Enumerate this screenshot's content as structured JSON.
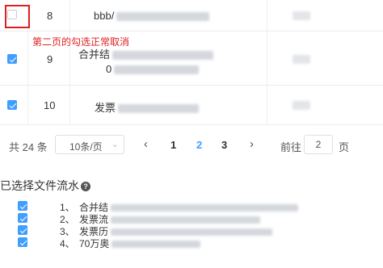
{
  "table": {
    "rows": [
      {
        "index": "8",
        "name_visible": "bbb/",
        "checked": false
      },
      {
        "index": "9",
        "name_visible": "合并结",
        "name_line2": "0",
        "checked": true
      },
      {
        "index": "10",
        "name_visible": "发票",
        "checked": true
      }
    ]
  },
  "annotation": "第二页的勾选正常取消",
  "pagination": {
    "total": "共 24 条",
    "page_size": "10条/页",
    "prev_symbol": "‹",
    "next_symbol": "›",
    "pages": [
      "1",
      "2",
      "3"
    ],
    "current_page": "2",
    "goto_label": "前往",
    "goto_value": "2",
    "goto_unit": "页"
  },
  "selected": {
    "title": "已选择文件流水",
    "help_icon": "?",
    "items": [
      {
        "index": "1、",
        "name_visible": "合并结",
        "checked": true
      },
      {
        "index": "2、",
        "name_visible": "发票流",
        "checked": true
      },
      {
        "index": "3、",
        "name_visible": "发票历",
        "checked": true
      },
      {
        "index": "4、",
        "name_visible": "70万奥",
        "checked": true
      }
    ]
  },
  "colors": {
    "primary": "#409eff",
    "annotation_red": "#e02020",
    "border": "#e9ecf1"
  }
}
